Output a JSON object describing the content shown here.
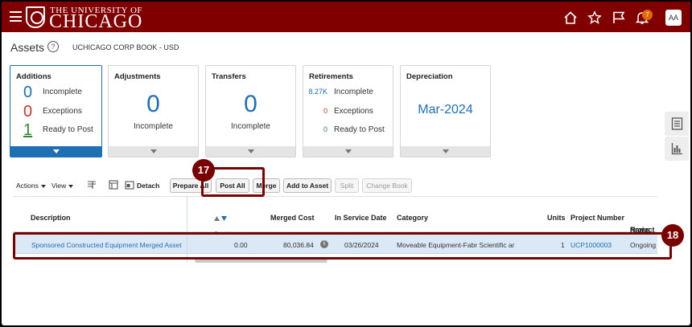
{
  "header": {
    "brand_top": "THE UNIVERSITY OF",
    "brand_main": "CHICAGO",
    "notification_count": "7",
    "avatar": "AA",
    "icons": [
      "menu-icon",
      "home-icon",
      "star-icon",
      "flag-icon",
      "bell-icon"
    ]
  },
  "page": {
    "title": "Assets",
    "help": "?",
    "book": "UCHICAGO CORP BOOK - USD"
  },
  "cards": {
    "additions": {
      "title": "Additions",
      "rows": [
        {
          "value": "0",
          "label": "Incomplete",
          "color": "#1f6fb5"
        },
        {
          "value": "0",
          "label": "Exceptions",
          "color": "#c0392b"
        },
        {
          "value": "1",
          "label": "Ready to Post",
          "color": "#2e8b2e"
        }
      ]
    },
    "adjustments": {
      "title": "Adjustments",
      "value": "0",
      "label": "Incomplete"
    },
    "transfers": {
      "title": "Transfers",
      "value": "0",
      "label": "Incomplete"
    },
    "retirements": {
      "title": "Retirements",
      "rows": [
        {
          "value": "8.27K",
          "label": "Incomplete",
          "color": "#1f6fb5"
        },
        {
          "value": "0",
          "label": "Exceptions",
          "color": "#c0392b"
        },
        {
          "value": "0",
          "label": "Ready to Post",
          "color": "#2e8b2e"
        }
      ]
    },
    "depreciation": {
      "title": "Depreciation",
      "value": "Mar-2024"
    }
  },
  "toolbar": {
    "actions": "Actions",
    "view": "View",
    "detach": "Detach",
    "prepare": "Prepare All",
    "post_all": "Post All",
    "merge": "Merge",
    "add_to_asset": "Add to Asset",
    "split": "Split",
    "change_book": "Change Book"
  },
  "table": {
    "headers": {
      "description": "Description",
      "cost": "Cost",
      "merged_cost": "Merged Cost",
      "in_service_date": "In Service Date",
      "category": "Category",
      "units": "Units",
      "project_number": "Project Number",
      "project_name_1": "Project",
      "project_name_2": "Name"
    },
    "rows": [
      {
        "description": "Sponsored Constructed Equipment Merged Asset",
        "cost": "0.00",
        "merged_cost": "80,036.84",
        "in_service_date": "03/26/2024",
        "category": "Moveable Equipment-Fabr Scientific ar",
        "units": "1",
        "project_number": "UCP1000003",
        "project_name": "Ongoing"
      }
    ]
  },
  "callouts": {
    "a": "17",
    "b": "18"
  },
  "colors": {
    "brand": "#800000",
    "accent": "#1f6fb5",
    "callout": "#7a0000"
  }
}
